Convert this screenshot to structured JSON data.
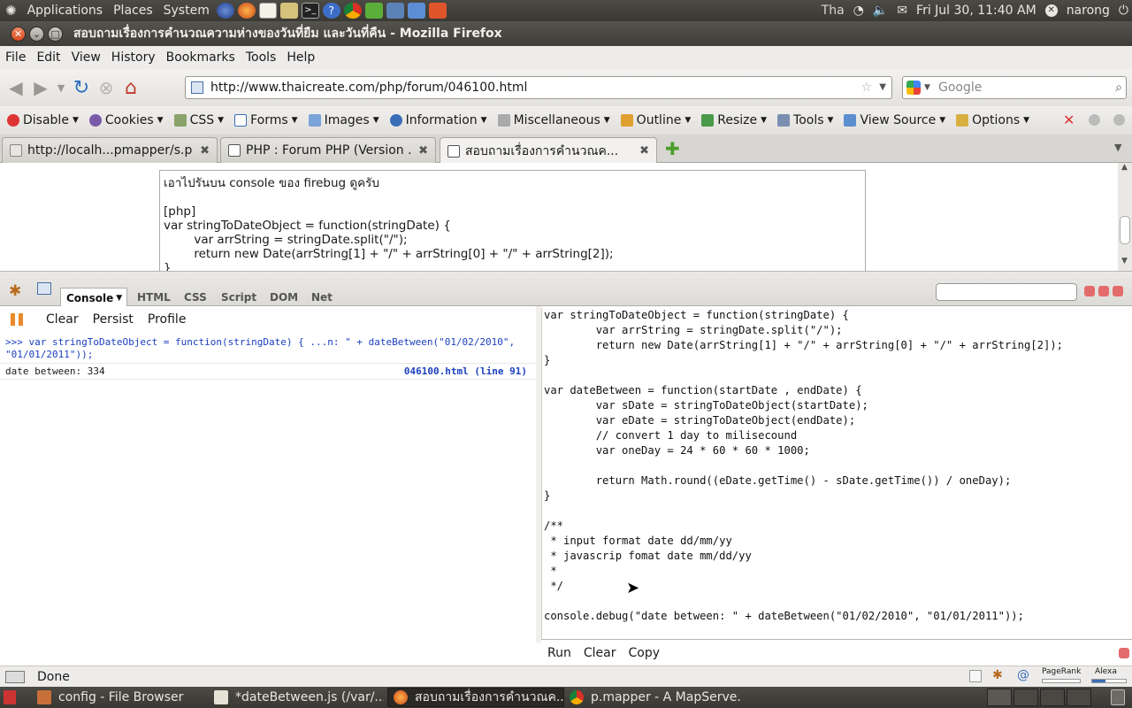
{
  "top_panel": {
    "menus": [
      "Applications",
      "Places",
      "System"
    ],
    "lang": "Tha",
    "datetime": "Fri Jul 30, 11:40 AM",
    "user": "narong"
  },
  "window": {
    "title": "สอบถามเรื่องการคำนวณความห่างของวันที่ยืม และวันที่คืน - Mozilla Firefox"
  },
  "menubar": [
    "File",
    "Edit",
    "View",
    "History",
    "Bookmarks",
    "Tools",
    "Help"
  ],
  "navbar": {
    "url": "http://www.thaicreate.com/php/forum/046100.html",
    "search_placeholder": "Google"
  },
  "devbar": {
    "items": [
      "Disable",
      "Cookies",
      "CSS",
      "Forms",
      "Images",
      "Information",
      "Miscellaneous",
      "Outline",
      "Resize",
      "Tools",
      "View Source",
      "Options"
    ]
  },
  "tabs": [
    {
      "label": "http://localh...pmapper/s.php"
    },
    {
      "label": "PHP : Forum PHP (Version ..."
    },
    {
      "label": "สอบถามเรื่องการคำนวณค..."
    }
  ],
  "page": {
    "post_text": "เอาไปรันบน console ของ firebug ดูครับ\n\n[php]\nvar stringToDateObject = function(stringDate) {\n        var arrString = stringDate.split(\"/\");\n        return new Date(arrString[1] + \"/\" + arrString[0] + \"/\" + arrString[2]);\n}"
  },
  "firebug": {
    "tabs": [
      "Console",
      "HTML",
      "CSS",
      "Script",
      "DOM",
      "Net"
    ],
    "console_buttons": [
      "Clear",
      "Persist",
      "Profile"
    ],
    "log_command": ">>> var stringToDateObject = function(stringDate) { ...n: \" + dateBetween(\"01/02/2010\", \"01/01/2011\"));",
    "log_output": "date between: 334",
    "log_source": "046100.html (line 91)",
    "editor_code": "var stringToDateObject = function(stringDate) {\n        var arrString = stringDate.split(\"/\");\n        return new Date(arrString[1] + \"/\" + arrString[0] + \"/\" + arrString[2]);\n}\n\nvar dateBetween = function(startDate , endDate) {\n        var sDate = stringToDateObject(startDate);\n        var eDate = stringToDateObject(endDate);\n        // convert 1 day to milisecound\n        var oneDay = 24 * 60 * 60 * 1000;\n\n        return Math.round((eDate.getTime() - sDate.getTime()) / oneDay);\n}\n\n/**\n * input format date dd/mm/yy\n * javascrip fomat date mm/dd/yy\n *\n */\n\nconsole.debug(\"date between: \" + dateBetween(\"01/02/2010\", \"01/01/2011\"));",
    "editor_buttons": [
      "Run",
      "Clear",
      "Copy"
    ]
  },
  "status": {
    "text": "Done",
    "pagerank_label": "PageRank",
    "alexa_label": "Alexa"
  },
  "taskbar": [
    {
      "label": "config - File Browser"
    },
    {
      "label": "*dateBetween.js (/var/..."
    },
    {
      "label": "สอบถามเรื่องการคำนวณค..."
    },
    {
      "label": "p.mapper - A MapServe..."
    }
  ],
  "colors": {
    "accent_blue": "#1a3fbf",
    "panel_dark": "#3a3833",
    "close_orange": "#d9471c"
  }
}
